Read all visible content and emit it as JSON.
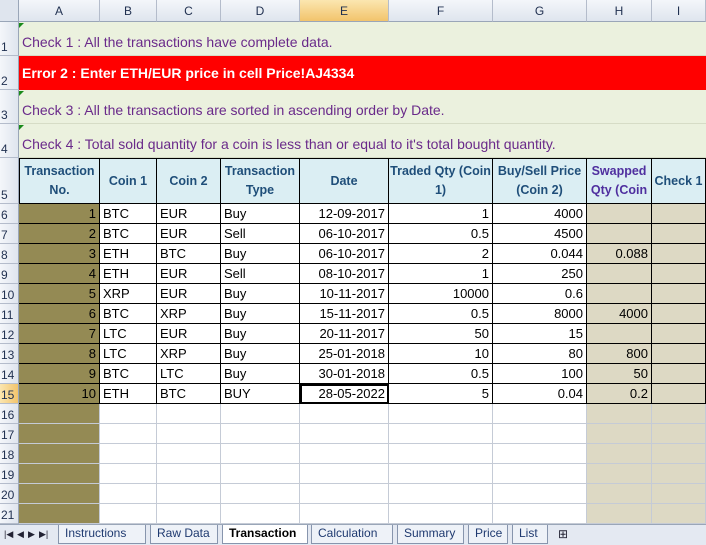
{
  "columns": [
    "A",
    "B",
    "C",
    "D",
    "E",
    "F",
    "G",
    "H",
    "I"
  ],
  "row_numbers": [
    "1",
    "2",
    "3",
    "4",
    "5",
    "6",
    "7",
    "8",
    "9",
    "10",
    "11",
    "12",
    "13",
    "14",
    "15",
    "16",
    "17",
    "18",
    "19",
    "20",
    "21"
  ],
  "checks": {
    "check1": "Check 1 : All the transactions have complete data.",
    "error2": "Error 2 : Enter ETH/EUR price in cell Price!AJ4334",
    "check3": "Check 3 : All the transactions are sorted in ascending order by Date.",
    "check4": "Check 4 : Total sold quantity for a coin is less than or equal to it's total bought quantity."
  },
  "table": {
    "headers": {
      "transaction_no": "Transaction No.",
      "coin1": "Coin 1",
      "coin2": "Coin 2",
      "type": "Transaction Type",
      "date": "Date",
      "traded_qty": "Traded Qty (Coin 1)",
      "price": "Buy/Sell Price (Coin 2)",
      "swapped": "Swapped Qty (Coin",
      "check1": "Check 1"
    },
    "rows": [
      {
        "no": "1",
        "coin1": "BTC",
        "coin2": "EUR",
        "type": "Buy",
        "date": "12-09-2017",
        "qty": "1",
        "price": "4000",
        "swapped": ""
      },
      {
        "no": "2",
        "coin1": "BTC",
        "coin2": "EUR",
        "type": "Sell",
        "date": "06-10-2017",
        "qty": "0.5",
        "price": "4500",
        "swapped": ""
      },
      {
        "no": "3",
        "coin1": "ETH",
        "coin2": "BTC",
        "type": "Buy",
        "date": "06-10-2017",
        "qty": "2",
        "price": "0.044",
        "swapped": "0.088"
      },
      {
        "no": "4",
        "coin1": "ETH",
        "coin2": "EUR",
        "type": "Sell",
        "date": "08-10-2017",
        "qty": "1",
        "price": "250",
        "swapped": ""
      },
      {
        "no": "5",
        "coin1": "XRP",
        "coin2": "EUR",
        "type": "Buy",
        "date": "10-11-2017",
        "qty": "10000",
        "price": "0.6",
        "swapped": ""
      },
      {
        "no": "6",
        "coin1": "BTC",
        "coin2": "XRP",
        "type": "Buy",
        "date": "15-11-2017",
        "qty": "0.5",
        "price": "8000",
        "swapped": "4000"
      },
      {
        "no": "7",
        "coin1": "LTC",
        "coin2": "EUR",
        "type": "Buy",
        "date": "20-11-2017",
        "qty": "50",
        "price": "15",
        "swapped": ""
      },
      {
        "no": "8",
        "coin1": "LTC",
        "coin2": "XRP",
        "type": "Buy",
        "date": "25-01-2018",
        "qty": "10",
        "price": "80",
        "swapped": "800"
      },
      {
        "no": "9",
        "coin1": "BTC",
        "coin2": "LTC",
        "type": "Buy",
        "date": "30-01-2018",
        "qty": "0.5",
        "price": "100",
        "swapped": "50"
      },
      {
        "no": "10",
        "coin1": "ETH",
        "coin2": "BTC",
        "type": "BUY",
        "date": "28-05-2022",
        "qty": "5",
        "price": "0.04",
        "swapped": "0.2"
      }
    ]
  },
  "sheet_tabs": [
    "Instructions",
    "Raw Data",
    "Transaction",
    "Calculation",
    "Summary",
    "Price",
    "List"
  ],
  "active_tab": "Transaction",
  "selected_cell": "E15",
  "colors": {
    "error_bg": "#ff0000",
    "check_text": "#6a2a8a",
    "header_bg": "#dbeef3",
    "olive": "#948a54",
    "tan": "#ddd9c4"
  }
}
